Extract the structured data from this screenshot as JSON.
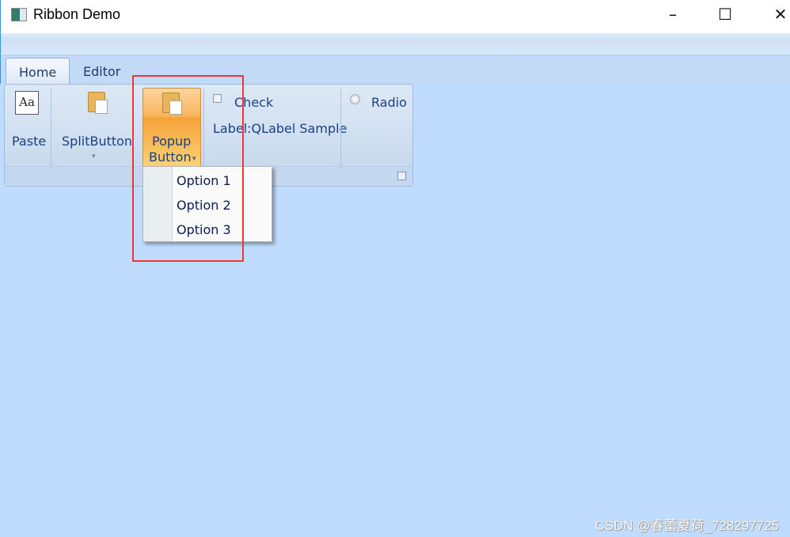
{
  "window": {
    "title": "Ribbon Demo",
    "minimize": "–",
    "maximize": "☐",
    "close": "✕"
  },
  "tabs": [
    {
      "label": "Home",
      "active": true
    },
    {
      "label": "Editor",
      "active": false
    }
  ],
  "ribbon": {
    "paste_label": "Paste",
    "split_button_label": "SplitButton",
    "popup_button_label_1": "Popup",
    "popup_button_label_2": "Button",
    "check_label": "Check",
    "check_checked": false,
    "label_text": "Label:QLabel Sample",
    "radio_label": "Radio",
    "radio_checked": false,
    "dropdown_arrow": "▾"
  },
  "popup_menu": {
    "items": [
      "Option 1",
      "Option 2",
      "Option 3"
    ]
  },
  "watermark": "CSDN @春蕾夏荷_728297725",
  "colors": {
    "background": "#bfdbfd",
    "popup_active": "#f6a238",
    "highlight_box": "#ee3636"
  }
}
